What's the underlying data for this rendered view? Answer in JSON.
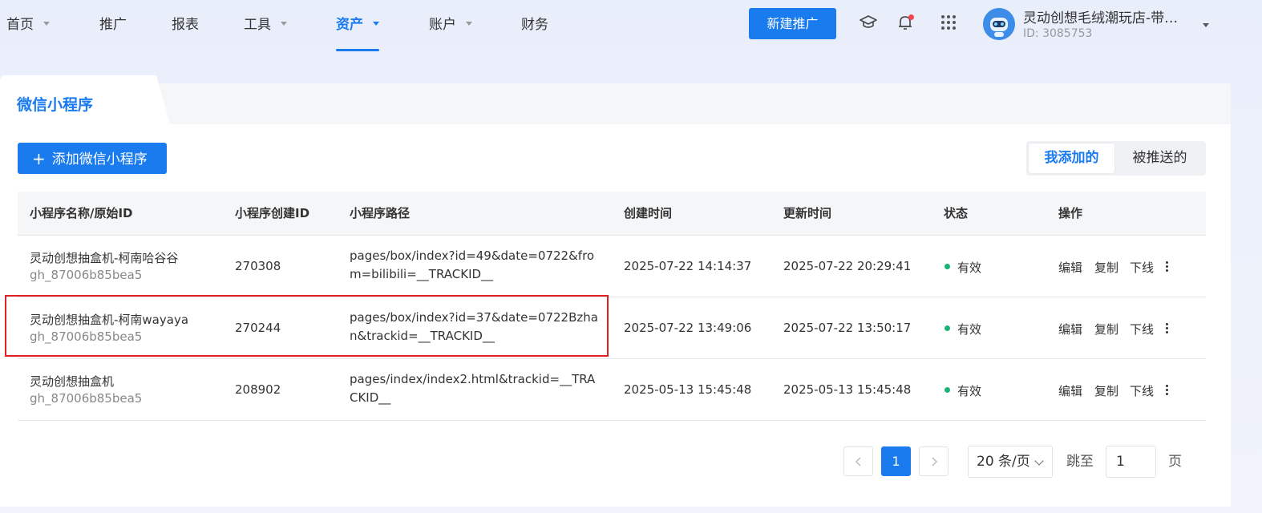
{
  "nav": {
    "items": [
      {
        "label": "首页",
        "has_caret": true
      },
      {
        "label": "推广",
        "has_caret": false
      },
      {
        "label": "报表",
        "has_caret": false
      },
      {
        "label": "工具",
        "has_caret": true
      },
      {
        "label": "资产",
        "has_caret": true,
        "active": true
      },
      {
        "label": "账户",
        "has_caret": true
      },
      {
        "label": "财务",
        "has_caret": false
      }
    ],
    "new_button": "新建推广",
    "icons": [
      "graduation-cap-icon",
      "bell-icon",
      "apps-grid-icon"
    ],
    "account_name": "灵动创想毛绒潮玩店-带…",
    "account_id": "ID: 3085753"
  },
  "panel": {
    "tab_title": "微信小程序",
    "add_button": "添加微信小程序",
    "segment": {
      "mine": "我添加的",
      "pushed": "被推送的"
    }
  },
  "table": {
    "headers": [
      "小程序名称/原始ID",
      "小程序创建ID",
      "小程序路径",
      "创建时间",
      "更新时间",
      "状态",
      "操作"
    ],
    "rows": [
      {
        "name": "灵动创想抽盒机-柯南哈谷谷",
        "orig_id": "gh_87006b85bea5",
        "create_id": "270308",
        "path": "pages/box/index?id=49&date=0722&from=bilibili=__TRACKID__",
        "created": "2025-07-22 14:14:37",
        "updated": "2025-07-22 20:29:41",
        "status": "有效"
      },
      {
        "name": "灵动创想抽盒机-柯南wayaya",
        "orig_id": "gh_87006b85bea5",
        "create_id": "270244",
        "path": "pages/box/index?id=37&date=0722Bzhan&trackid=__TRACKID__",
        "created": "2025-07-22 13:49:06",
        "updated": "2025-07-22 13:50:17",
        "status": "有效"
      },
      {
        "name": "灵动创想抽盒机",
        "orig_id": "gh_87006b85bea5",
        "create_id": "208902",
        "path": "pages/index/index2.html&trackid=__TRACKID__",
        "created": "2025-05-13 15:45:48",
        "updated": "2025-05-13 15:45:48",
        "status": "有效"
      }
    ],
    "actions": {
      "edit": "编辑",
      "copy": "复制",
      "offline": "下线"
    }
  },
  "pagination": {
    "current_page": "1",
    "page_size": "20 条/页",
    "jump_label": "跳至",
    "jump_value": "1",
    "page_suffix": "页"
  },
  "colors": {
    "accent": "#1a7bef",
    "status_ok": "#19b377",
    "highlight": "#e02020"
  }
}
